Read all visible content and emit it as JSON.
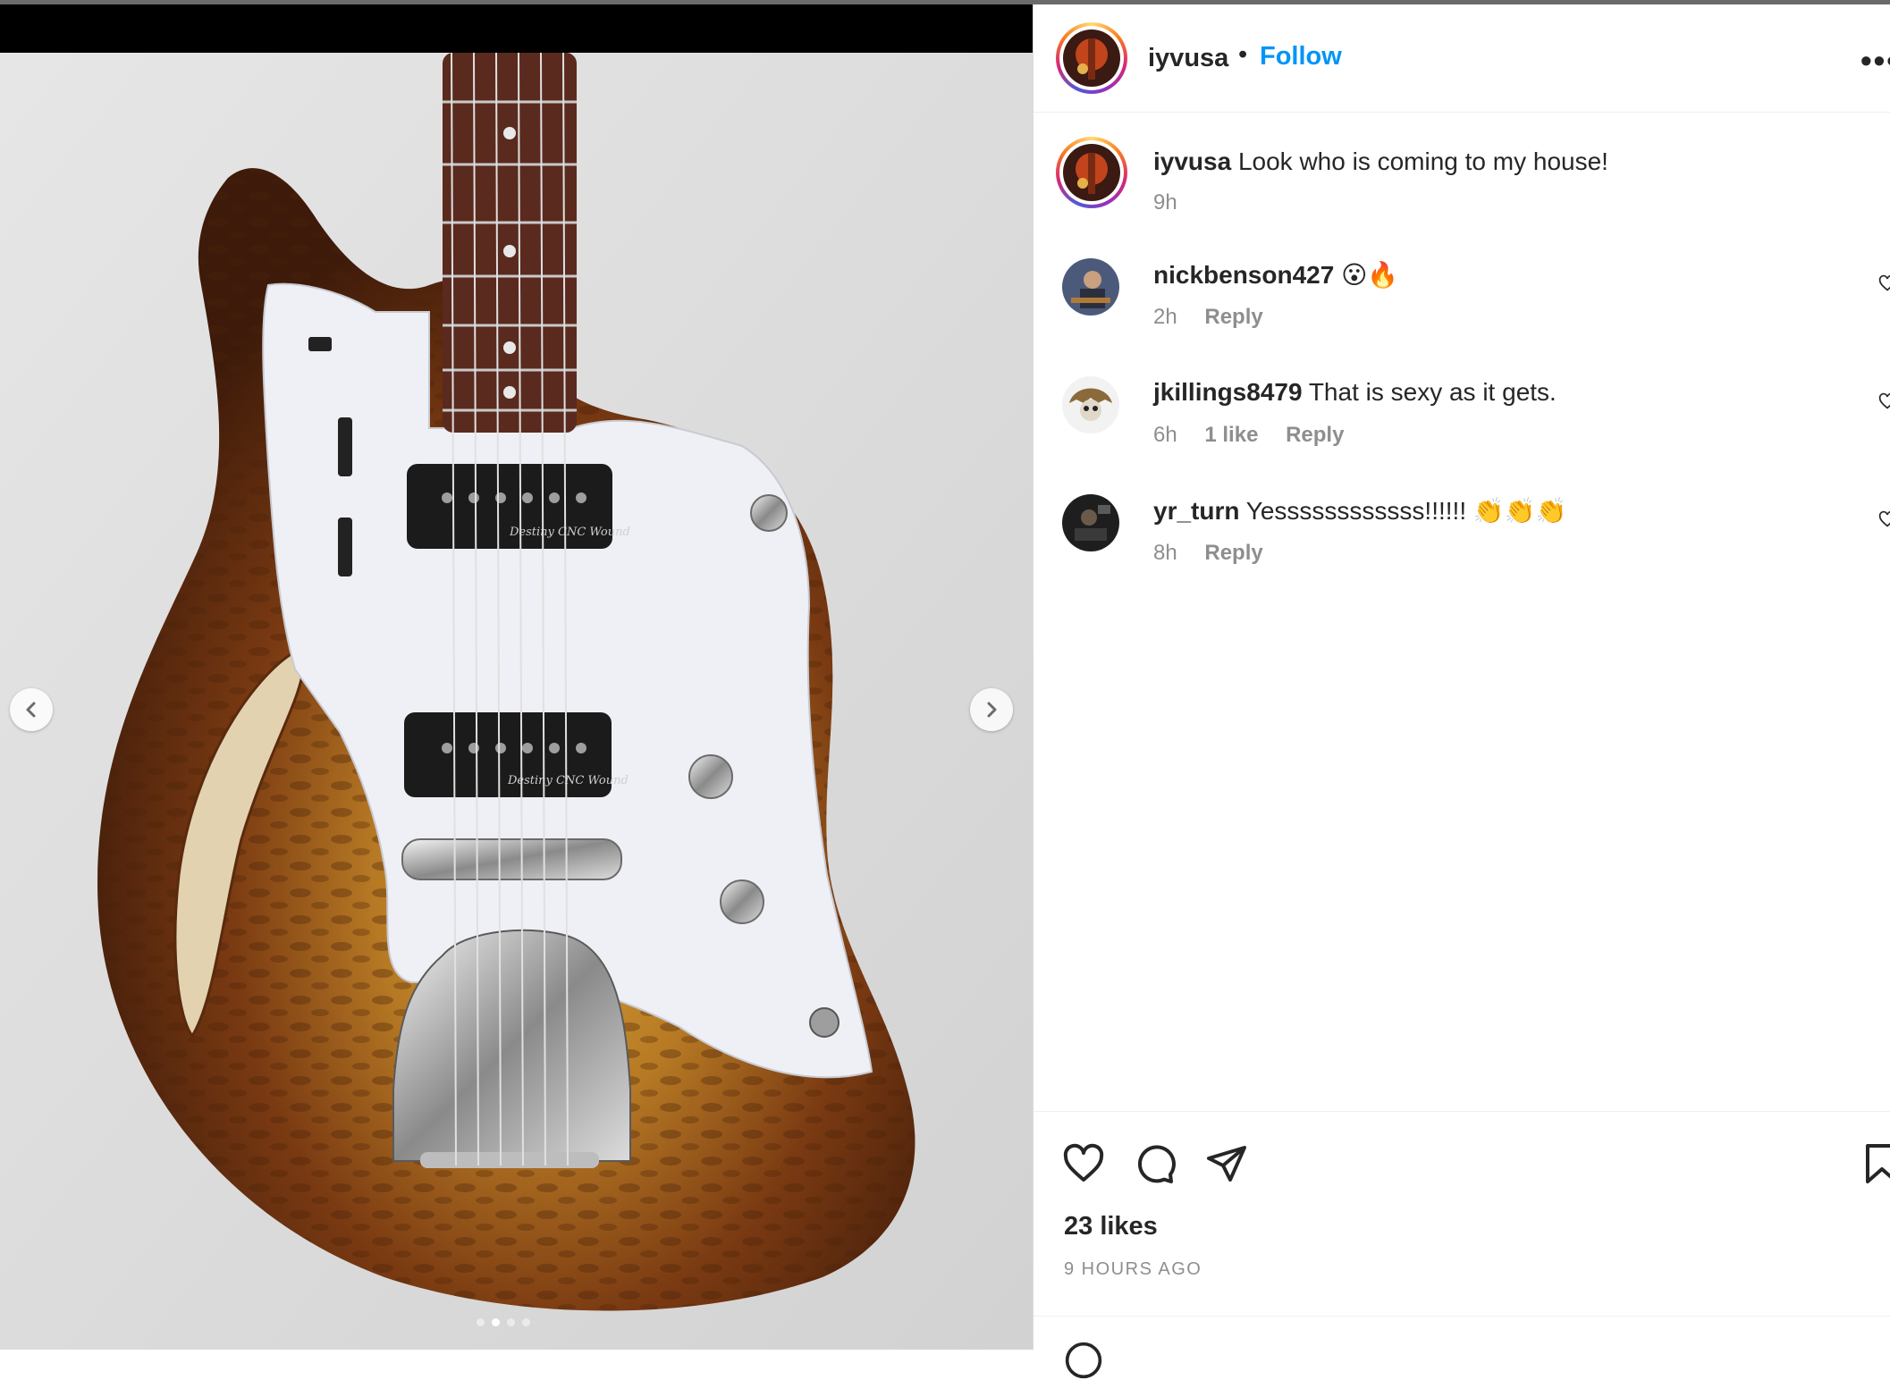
{
  "post": {
    "username": "iyvusa",
    "separator": "•",
    "follow_label": "Follow",
    "more_label": "•••",
    "caption": "Look who is coming to my house!",
    "caption_time": "9h",
    "likes": "23 likes",
    "time_ago": "9 HOURS AGO",
    "media_dots": 4,
    "active_dot": 1
  },
  "photo": {
    "pickup_text_1": "Destiny CNC Wound",
    "pickup_text_2": "Destiny CNC Wound"
  },
  "comments": [
    {
      "username": "nickbenson427",
      "text": "😮🔥",
      "time": "2h",
      "likes": "",
      "reply_label": "Reply"
    },
    {
      "username": "jkillings8479",
      "text": "That is sexy as it gets.",
      "time": "6h",
      "likes": "1 like",
      "reply_label": "Reply"
    },
    {
      "username": "yr_turn",
      "text": "Yessssssssssss!!!!!! 👏👏👏",
      "time": "8h",
      "likes": "",
      "reply_label": "Reply"
    }
  ],
  "colors": {
    "follow": "#0095f6",
    "secondary_text": "#8e8e8e",
    "border": "#dbdbdb"
  },
  "icons": {
    "like": "heart-icon",
    "comment": "comment-icon",
    "share": "paper-plane-icon",
    "save": "bookmark-icon",
    "more": "more-icon",
    "prev": "chevron-left-icon",
    "next": "chevron-right-icon"
  }
}
